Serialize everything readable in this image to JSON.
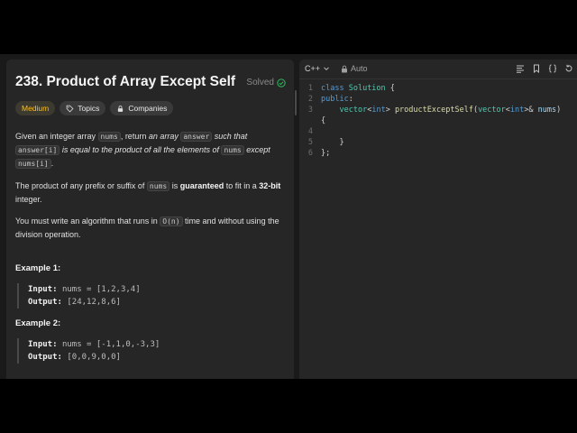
{
  "problem": {
    "title": "238. Product of Array Except Self",
    "status": "Solved",
    "tags": {
      "difficulty": "Medium",
      "topics": "Topics",
      "companies": "Companies"
    }
  },
  "description": {
    "p1": {
      "a": "Given an integer array ",
      "b": "nums",
      "c": ", return ",
      "d": "an array ",
      "e": "answer",
      "f": " such that ",
      "g": "answer[i]",
      "h": " is equal to the product of all the elements of ",
      "i": "nums",
      "j": " except ",
      "k": "nums[i]",
      "l": "."
    },
    "p2": {
      "a": "The product of any prefix or suffix of ",
      "b": "nums",
      "c": " is ",
      "d": "guaranteed",
      "e": " to fit in a ",
      "f": "32-bit",
      "g": " integer."
    },
    "p3": {
      "a": "You must write an algorithm that runs in ",
      "b": "O(n)",
      "c": " time and without using the division operation."
    }
  },
  "examples": [
    {
      "title": "Example 1:",
      "input_label": "Input:",
      "input": "nums = [1,2,3,4]",
      "output_label": "Output:",
      "output": "[24,12,8,6]"
    },
    {
      "title": "Example 2:",
      "input_label": "Input:",
      "input": "nums = [-1,1,0,-3,3]",
      "output_label": "Output:",
      "output": "[0,0,9,0,0]"
    }
  ],
  "editor": {
    "language": "C++",
    "mode": "Auto",
    "lines": [
      {
        "n": "1",
        "t": [
          [
            "kw",
            "class "
          ],
          [
            "ty",
            "Solution "
          ],
          [
            "op",
            "{"
          ]
        ]
      },
      {
        "n": "2",
        "t": [
          [
            "kw",
            "public"
          ],
          [
            "op",
            ":"
          ]
        ]
      },
      {
        "n": "3",
        "t": [
          [
            "op",
            "    "
          ],
          [
            "ty",
            "vector"
          ],
          [
            "op",
            "<"
          ],
          [
            "kw",
            "int"
          ],
          [
            "op",
            "> "
          ],
          [
            "fn",
            "productExceptSelf"
          ],
          [
            "op",
            "("
          ],
          [
            "ty",
            "vector"
          ],
          [
            "op",
            "<"
          ],
          [
            "kw",
            "int"
          ],
          [
            "op",
            ">& "
          ],
          [
            "pm",
            "nums"
          ],
          [
            "op",
            ")"
          ]
        ]
      },
      {
        "n": "",
        "t": [
          [
            "op",
            "{"
          ]
        ]
      },
      {
        "n": "4",
        "t": [
          [
            "op",
            " "
          ]
        ]
      },
      {
        "n": "5",
        "t": [
          [
            "op",
            "    }"
          ]
        ]
      },
      {
        "n": "6",
        "t": [
          [
            "op",
            "};"
          ]
        ]
      }
    ]
  },
  "colors": {
    "accent_medium": "#ffc01e",
    "solved_check": "#2cbb5d",
    "background": "#262626"
  }
}
